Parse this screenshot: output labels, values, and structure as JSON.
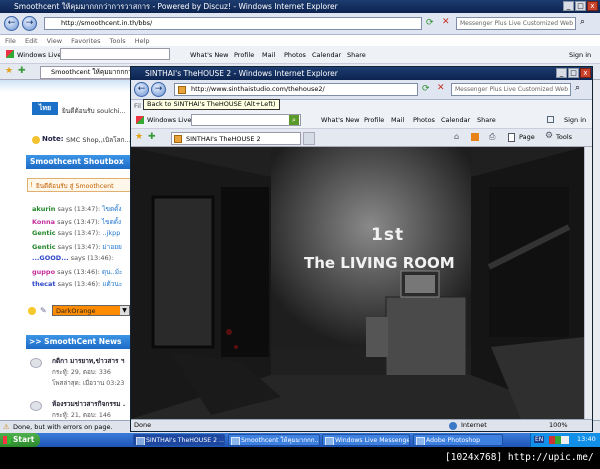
{
  "back_window": {
    "title": "Smoothcent ให้คุมมากกกว่าการวาสการ - Powered by Discuz! - Windows Internet Explorer",
    "address": "http://smoothcent.in.th/bbs/",
    "search_placeholder": "Messenger Plus Live Customized Web S",
    "menu": [
      "File",
      "Edit",
      "View",
      "Favorites",
      "Tools",
      "Help"
    ],
    "live_label": "Windows Live",
    "live_links": [
      "What's New",
      "Profile",
      "Mail",
      "Photos",
      "Calendar",
      "Share"
    ],
    "sign_in": "Sign in",
    "tab": "Smoothcent ให้คุมมากกกว่า...",
    "status": "Done, but with errors on page.",
    "page": {
      "thai_button": "ไทย",
      "welcome": "ยินดีต้อนรับ soulchi...",
      "note_label": "Note:",
      "note_text": "SMC Shop,,เบิลโลก...",
      "shoutbox_title": "Smoothcent Shoutbox",
      "shoutbox_welcome": "ยินดีต้อนรับ สู่ Smoothcent",
      "shouts": [
        {
          "user": "akurin",
          "time": "says (13:47):",
          "msg": "ไขดดั้ง",
          "color": "#22862a"
        },
        {
          "user": "Konna",
          "time": "says (13:47):",
          "msg": "ไขดดั้ง",
          "color": "#c22e9b"
        },
        {
          "user": "Gentic",
          "time": "says (13:47):",
          "msg": "..jkpp",
          "color": "#22862a"
        },
        {
          "user": "Gentic",
          "time": "says (13:47):",
          "msg": "ม่าอยย",
          "color": "#22862a"
        },
        {
          "user": "...GOOD...",
          "time": "says (13:46):",
          "msg": "",
          "color": "#2d46c8"
        },
        {
          "user": "guppo",
          "time": "says (13:46):",
          "msg": "ดุน..ม้ะ",
          "color": "#c22e9b"
        },
        {
          "user": "thecat",
          "time": "says (13:46):",
          "msg": "แต้วนะ",
          "color": "#2d46c8"
        }
      ],
      "color_select": "DarkOrange",
      "news_title": ">> SmoothCent News",
      "news": [
        {
          "title": "กติกา มารยาท,ข่าวสาร ฯ",
          "line2": "กระทู้: 29, ตอบ: 336",
          "line3": "โพสล่าสุด: เมื่อวาน 03:23"
        },
        {
          "title": "ห้องรวมข่าวสารกิจกรรม .",
          "line2": "กระทู้: 21, ตอบ: 146",
          "line3": ""
        }
      ]
    }
  },
  "front_window": {
    "title": "SINTHAI's TheHOUSE 2 - Windows Internet Explorer",
    "address": "http://www.sinthaistudio.com/thehouse2/",
    "search_placeholder": "Messenger Plus Live Customized Web S",
    "tooltip": "Back to SINTHAI's TheHOUSE (Alt+Left)",
    "live_label": "Windows Live",
    "live_links": [
      "What's New",
      "Profile",
      "Mail",
      "Photos",
      "Calendar",
      "Share"
    ],
    "sign_in": "Sign in",
    "tab": "SINTHAI's TheHOUSE 2",
    "page_btn": "Page",
    "tools_btn": "Tools",
    "room_number": "1st",
    "room_name": "The LIVING ROOM",
    "status": "Done",
    "zone": "Internet",
    "zoom": "100%"
  },
  "taskbar": {
    "start": "Start",
    "tasks": [
      "SINTHAI's TheHOUSE 2 ...",
      "Smoothcent ให้คุมมากกก...",
      "Windows Live Messenger",
      "Adobe Photoshop"
    ],
    "lang": "EN",
    "clock": "13:40"
  },
  "watermark": "[1024x768] http://upic.me/"
}
